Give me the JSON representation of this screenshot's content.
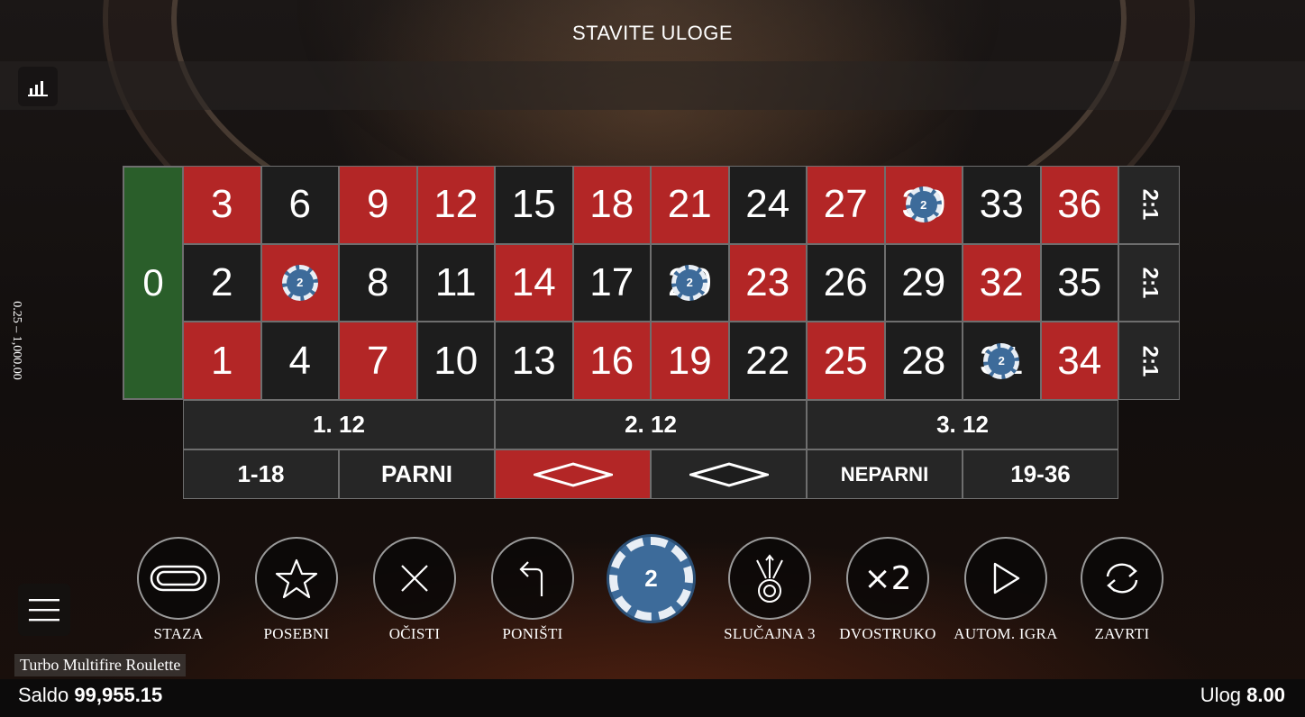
{
  "header": {
    "title": "STAVITE ULOGE"
  },
  "limits": "0.25 – 1,000.00",
  "table": {
    "zero": "0",
    "rows": [
      [
        {
          "n": "3",
          "c": "red"
        },
        {
          "n": "6",
          "c": "black"
        },
        {
          "n": "9",
          "c": "red"
        },
        {
          "n": "12",
          "c": "red"
        },
        {
          "n": "15",
          "c": "black"
        },
        {
          "n": "18",
          "c": "red"
        },
        {
          "n": "21",
          "c": "red"
        },
        {
          "n": "24",
          "c": "black"
        },
        {
          "n": "27",
          "c": "red"
        },
        {
          "n": "30",
          "c": "red"
        },
        {
          "n": "33",
          "c": "black"
        },
        {
          "n": "36",
          "c": "red"
        }
      ],
      [
        {
          "n": "2",
          "c": "black"
        },
        {
          "n": "5",
          "c": "red"
        },
        {
          "n": "8",
          "c": "black"
        },
        {
          "n": "11",
          "c": "black"
        },
        {
          "n": "14",
          "c": "red"
        },
        {
          "n": "17",
          "c": "black"
        },
        {
          "n": "20",
          "c": "black"
        },
        {
          "n": "23",
          "c": "red"
        },
        {
          "n": "26",
          "c": "black"
        },
        {
          "n": "29",
          "c": "black"
        },
        {
          "n": "32",
          "c": "red"
        },
        {
          "n": "35",
          "c": "black"
        }
      ],
      [
        {
          "n": "1",
          "c": "red"
        },
        {
          "n": "4",
          "c": "black"
        },
        {
          "n": "7",
          "c": "red"
        },
        {
          "n": "10",
          "c": "black"
        },
        {
          "n": "13",
          "c": "black"
        },
        {
          "n": "16",
          "c": "red"
        },
        {
          "n": "19",
          "c": "red"
        },
        {
          "n": "22",
          "c": "black"
        },
        {
          "n": "25",
          "c": "red"
        },
        {
          "n": "28",
          "c": "black"
        },
        {
          "n": "31",
          "c": "black"
        },
        {
          "n": "34",
          "c": "red"
        }
      ]
    ],
    "column_bets": [
      "2:1",
      "2:1",
      "2:1"
    ],
    "dozens": [
      "1. 12",
      "2. 12",
      "3. 12"
    ],
    "outside": {
      "low": "1-18",
      "even": "PARNI",
      "odd": "NEPARNI",
      "high": "19-36"
    },
    "placed_chips": [
      {
        "number": "30",
        "value": "2"
      },
      {
        "number": "5",
        "value": "2"
      },
      {
        "number": "20",
        "value": "2"
      },
      {
        "number": "31",
        "value": "2"
      }
    ]
  },
  "controls": [
    {
      "id": "staza",
      "label": "STAZA",
      "icon": "racetrack-icon"
    },
    {
      "id": "posebni",
      "label": "POSEBNI",
      "icon": "star-icon"
    },
    {
      "id": "ocisti",
      "label": "OČISTI",
      "icon": "close-icon"
    },
    {
      "id": "ponisti",
      "label": "PONIŠTI",
      "icon": "undo-icon"
    },
    {
      "id": "slucajna",
      "label": "SLUČAJNA 3",
      "icon": "random-icon"
    },
    {
      "id": "dvostruko",
      "label": "DVOSTRUKO",
      "icon": "double-icon"
    },
    {
      "id": "autom",
      "label": "AUTOM. IGRA",
      "icon": "autoplay-icon"
    },
    {
      "id": "zavrti",
      "label": "ZAVRTI",
      "icon": "spin-icon"
    }
  ],
  "selected_chip": "2",
  "game_name": "Turbo Multifire Roulette",
  "footer": {
    "balance_label": "Saldo",
    "balance_value": "99,955.15",
    "stake_label": "Ulog",
    "stake_value": "8.00"
  },
  "colors": {
    "red": "#b32626",
    "black": "#1d1d1d",
    "green": "#2a5e2a",
    "chip": "#3d6b9a"
  }
}
